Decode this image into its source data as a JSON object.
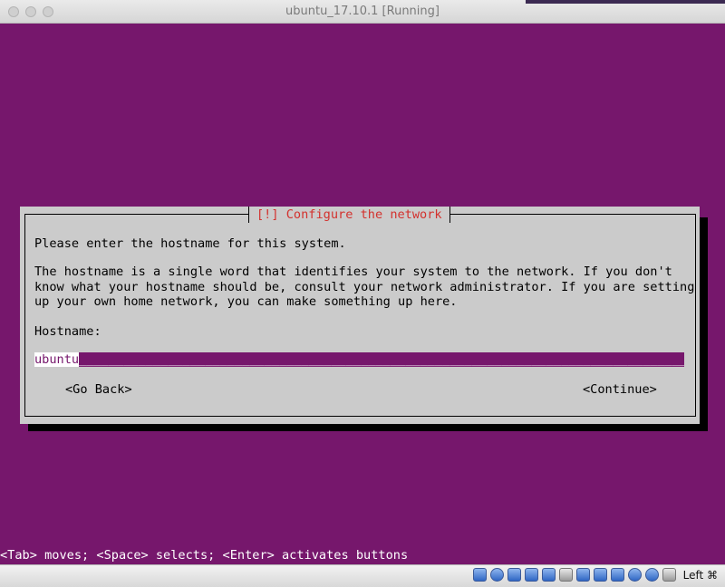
{
  "window": {
    "title": "ubuntu_17.10.1 [Running]"
  },
  "dialog": {
    "title": "[!] Configure the network",
    "prompt": "Please enter the hostname for this system.",
    "description": "The hostname is a single word that identifies your system to the network. If you don't\nknow what your hostname should be, consult your network administrator. If you are setting\nup your own home network, you can make something up here.",
    "field_label": "Hostname:",
    "hostname_value": "ubuntu",
    "hostname_fill": "________________________________________________________________________________________________",
    "go_back_label": "<Go Back>",
    "continue_label": "<Continue>"
  },
  "help_line": "<Tab> moves; <Space> selects; <Enter> activates buttons",
  "statusbar": {
    "icons": [
      "hard-disk-icon",
      "optical-drive-icon",
      "audio-icon",
      "network-icon",
      "usb-icon",
      "shared-folder-icon",
      "display-icon",
      "video-capture-icon",
      "recording-icon",
      "cpu-icon",
      "mouse-integration-icon",
      "keyboard-capture-icon"
    ],
    "host_key": "Left ⌘"
  },
  "colors": {
    "screen_background": "#76176c",
    "dialog_background": "#cbcbcb",
    "dialog_title": "#d3312d",
    "shadow": "#000000"
  }
}
